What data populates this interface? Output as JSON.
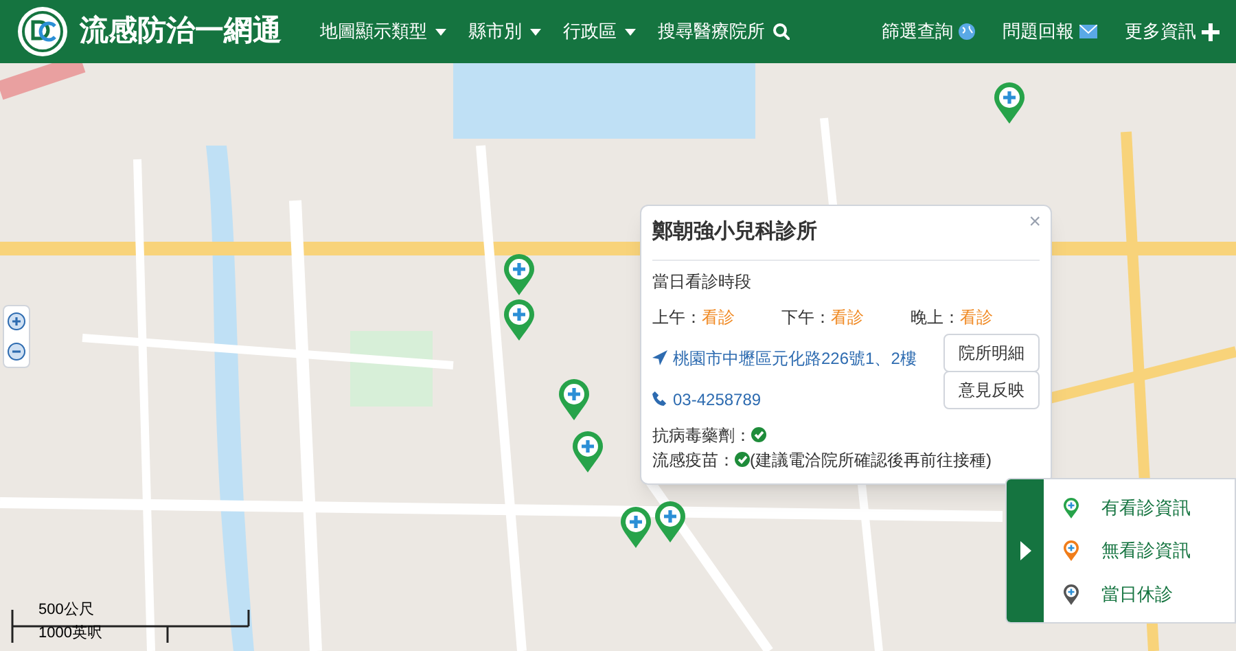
{
  "header": {
    "title": "流感防治一網通",
    "menus": [
      {
        "label": "地圖顯示類型",
        "kind": "dropdown"
      },
      {
        "label": "縣市別",
        "kind": "dropdown"
      },
      {
        "label": "行政區",
        "kind": "dropdown"
      },
      {
        "label": "搜尋醫療院所",
        "kind": "search"
      }
    ],
    "links": [
      {
        "label": "篩選查詢",
        "kind": "globe"
      },
      {
        "label": "問題回報",
        "kind": "mail"
      },
      {
        "label": "更多資訊",
        "kind": "plus"
      }
    ]
  },
  "map": {
    "markers": [
      {
        "color": "#27a34a"
      },
      {
        "color": "#27a34a"
      },
      {
        "color": "#27a34a"
      },
      {
        "color": "#27a34a"
      },
      {
        "color": "#27a34a"
      },
      {
        "color": "#27a34a"
      },
      {
        "color": "#27a34a"
      }
    ],
    "scale": {
      "metric": "500公尺",
      "imperial": "1000英呎"
    }
  },
  "popup": {
    "close": "×",
    "title": "鄭朝強小兒科診所",
    "section": "當日看診時段",
    "periods": [
      {
        "label": "上午：",
        "status": "看診"
      },
      {
        "label": "下午：",
        "status": "看診"
      },
      {
        "label": "晚上：",
        "status": "看診"
      }
    ],
    "address": "桃園市中壢區元化路226號1、2樓",
    "phone": "03-4258789",
    "buttons": [
      "院所明細",
      "意見反映"
    ],
    "antiviral": {
      "label": "抗病毒藥劑：",
      "available": true
    },
    "vaccine": {
      "label": "流感疫苗：",
      "available": true,
      "note": "(建議電洽院所確認後再前往接種)"
    }
  },
  "legend": {
    "items": [
      {
        "label": "有看診資訊",
        "color": "#27a34a"
      },
      {
        "label": "無看診資訊",
        "color": "#f07d1a"
      },
      {
        "label": "當日休診",
        "color": "#555555"
      }
    ]
  }
}
